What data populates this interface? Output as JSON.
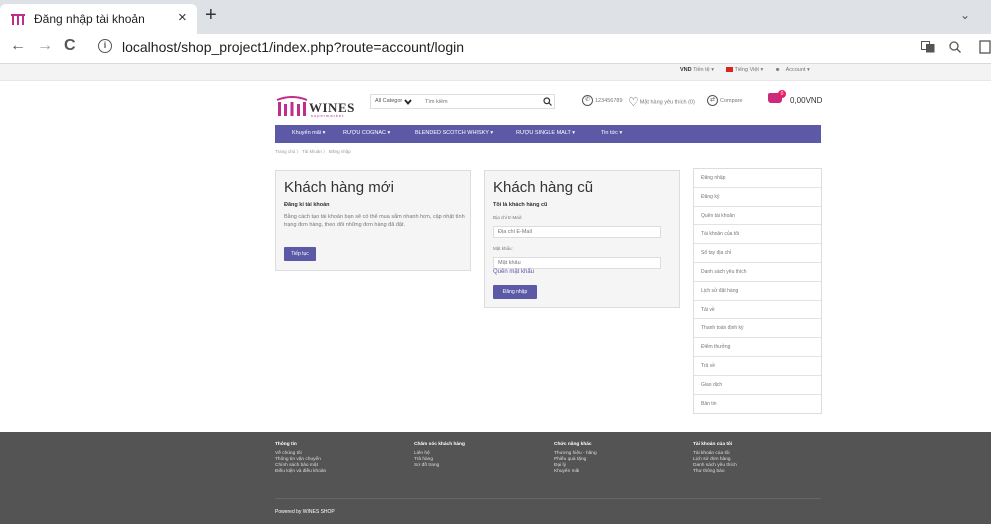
{
  "browser": {
    "tab_title": "Đăng nhập tài khoản",
    "tab_close": "×",
    "new_tab": "+",
    "tab_dropdown": "⌄",
    "url": "localhost/shop_project1/index.php?route=account/login",
    "back": "←",
    "forward": "→",
    "reload": "C",
    "info": "i"
  },
  "topbar": {
    "currency": "VND",
    "currency_label": "Tiền tệ ▾",
    "language": "Tiếng Việt ▾",
    "account": "Account ▾"
  },
  "header": {
    "logo_text": "WINES",
    "logo_sub": "supermarket",
    "search_category": "All Categor",
    "search_placeholder": "Tìm kiếm",
    "phone": "123456789",
    "wishlist": "Mặt hàng yêu thích (0)",
    "compare": "Compare",
    "cart_count": "0",
    "cart_total": "0,00VND"
  },
  "nav": {
    "items": [
      {
        "label": "Khuyến mãi ▾"
      },
      {
        "label": "RƯỢU COGNAC ▾"
      },
      {
        "label": "BLENDED SCOTCH WHISKY ▾"
      },
      {
        "label": "RƯỢU SINGLE MALT ▾"
      },
      {
        "label": "Tin tức ▾"
      }
    ]
  },
  "breadcrumb": "Trang chủ  〉 Tài khoản  〉 Đăng nhập",
  "new_customer": {
    "title": "Khách hàng mới",
    "subtitle": "Đăng kí tài khoản",
    "text": "Bằng cách tạo tài khoản bạn sẽ có thể mua sắm nhanh hơn, cập nhật tình trạng đơn hàng, theo dõi những đơn hàng đã đặt.",
    "button": "Tiếp tục"
  },
  "returning_customer": {
    "title": "Khách hàng cũ",
    "subtitle": "Tôi là khách hàng cũ",
    "email_label": "Địa chỉ E-Mail:",
    "email_placeholder": "Địa chỉ E-Mail",
    "password_label": "Mật khẩu:",
    "password_placeholder": "Mật khẩu",
    "forgot": "Quên mật khẩu",
    "button": "Đăng nhập"
  },
  "sidebar": {
    "items": [
      {
        "label": "Đăng nhập"
      },
      {
        "label": "Đăng ký"
      },
      {
        "label": "Quên tài khoản"
      },
      {
        "label": "Tài khoản của tôi"
      },
      {
        "label": "Sổ tay địa chỉ"
      },
      {
        "label": "Danh sách yêu thích"
      },
      {
        "label": "Lịch sử đặt hàng"
      },
      {
        "label": "Tải về"
      },
      {
        "label": "Thanh toán định kỳ"
      },
      {
        "label": "Điểm thưởng"
      },
      {
        "label": "Trả về"
      },
      {
        "label": "Giao dịch"
      },
      {
        "label": "Bản tin"
      }
    ]
  },
  "footer": {
    "columns": [
      {
        "heading": "Thông tin",
        "links": [
          "Về chúng tôi",
          "Thông tin vận chuyển",
          "Chính sách bảo mật",
          "Điều kiện và điều khoản"
        ]
      },
      {
        "heading": "Chăm sóc khách hàng",
        "links": [
          "Liên hệ",
          "Trả hàng",
          "Sơ đồ trang"
        ]
      },
      {
        "heading": "Chức năng khác",
        "links": [
          "Thương hiệu - hãng",
          "Phiếu quà tặng",
          "Đại lý",
          "Khuyến mãi"
        ]
      },
      {
        "heading": "Tài khoản của tôi",
        "links": [
          "Tài khoản của tôi",
          "Lịch sử đơn hàng",
          "Danh sách yêu thích",
          "Thư thông báo"
        ]
      }
    ],
    "powered": "Powered by WINES SHOP"
  },
  "colors": {
    "brand_purple": "#5c5aa7",
    "footer_bg": "#545454",
    "logo_magenta": "#bf2d8d"
  }
}
